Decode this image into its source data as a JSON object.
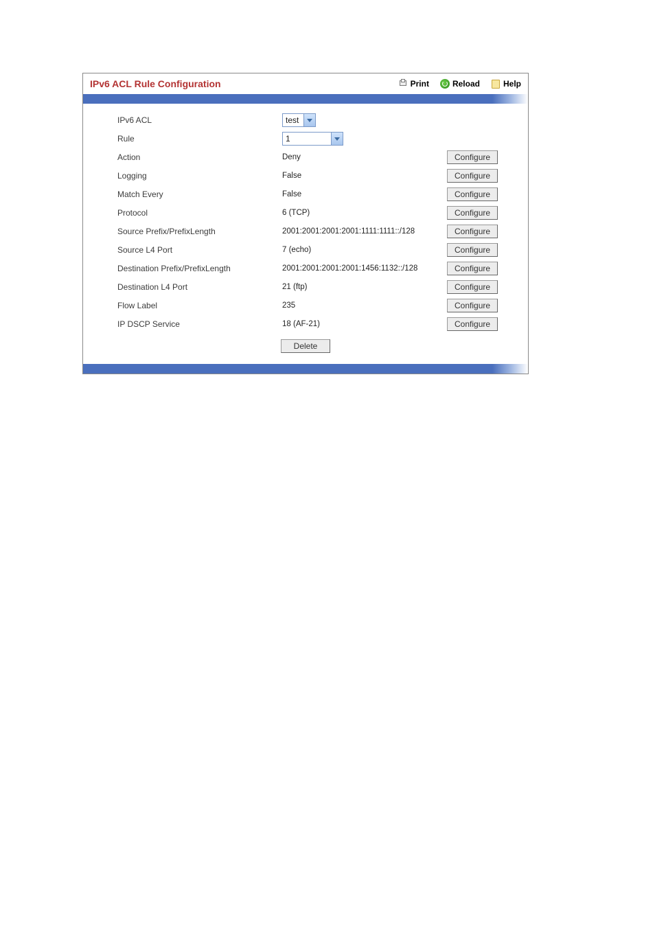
{
  "header": {
    "title": "IPv6 ACL Rule Configuration",
    "print": "Print",
    "reload": "Reload",
    "help": "Help"
  },
  "selects": {
    "ipv6_acl_label": "IPv6 ACL",
    "ipv6_acl_value": "test",
    "rule_label": "Rule",
    "rule_value": "1"
  },
  "rows": [
    {
      "label": "Action",
      "value": "Deny",
      "configure": true
    },
    {
      "label": "Logging",
      "value": "False",
      "configure": true
    },
    {
      "label": "Match Every",
      "value": "False",
      "configure": true
    },
    {
      "label": "Protocol",
      "value": "6 (TCP)",
      "configure": true
    },
    {
      "label": "Source Prefix/PrefixLength",
      "value": "2001:2001:2001:2001:1111:1111::/128",
      "configure": true
    },
    {
      "label": "Source L4 Port",
      "value": "7 (echo)",
      "configure": true
    },
    {
      "label": "Destination Prefix/PrefixLength",
      "value": "2001:2001:2001:2001:1456:1132::/128",
      "configure": true
    },
    {
      "label": "Destination L4 Port",
      "value": "21 (ftp)",
      "configure": true
    },
    {
      "label": "Flow Label",
      "value": "235",
      "configure": true
    },
    {
      "label": "IP DSCP Service",
      "value": "18 (AF-21)",
      "configure": true
    }
  ],
  "buttons": {
    "configure": "Configure",
    "delete": "Delete"
  }
}
